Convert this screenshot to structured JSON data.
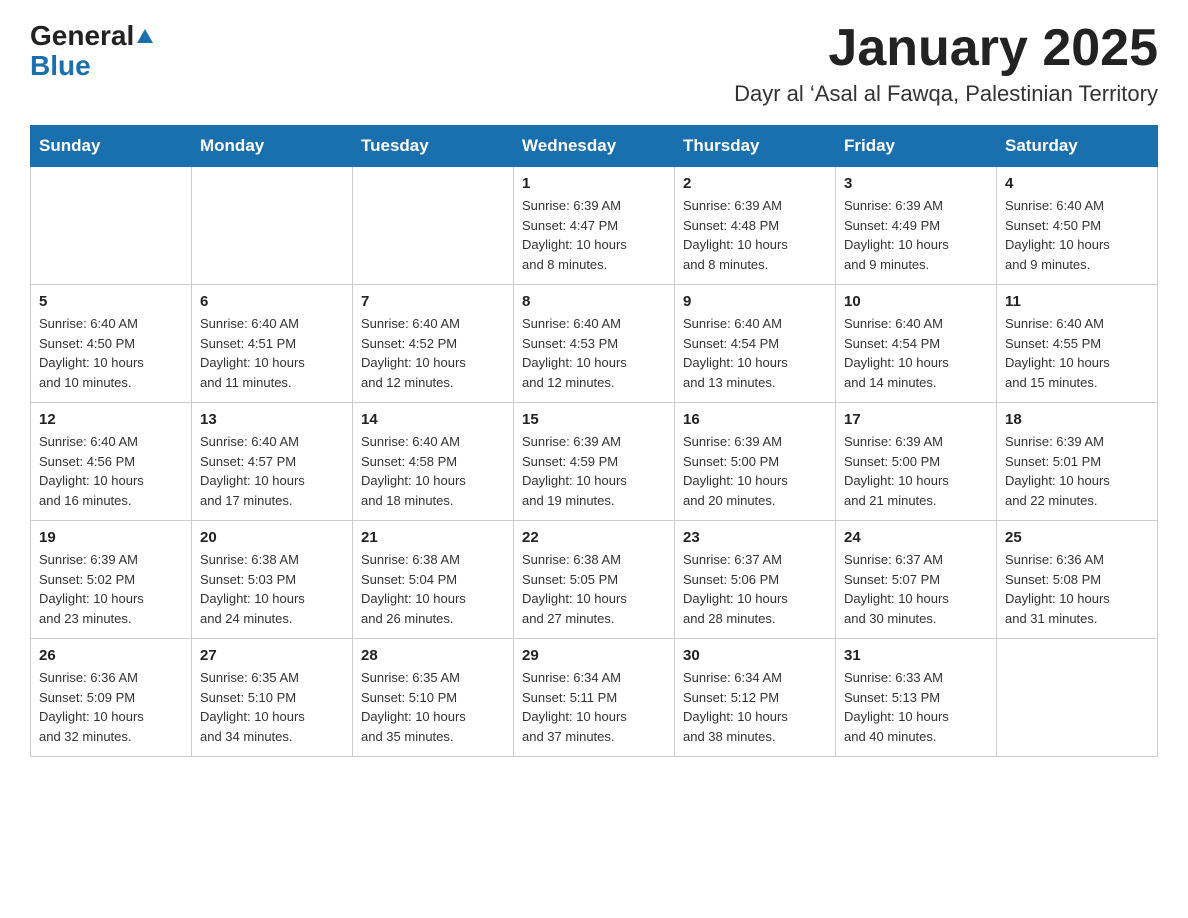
{
  "header": {
    "logo_general": "General",
    "logo_blue": "Blue",
    "title": "January 2025",
    "subtitle": "Dayr al ‘Asal al Fawqa, Palestinian Territory"
  },
  "weekdays": [
    "Sunday",
    "Monday",
    "Tuesday",
    "Wednesday",
    "Thursday",
    "Friday",
    "Saturday"
  ],
  "weeks": [
    [
      {
        "day": "",
        "info": ""
      },
      {
        "day": "",
        "info": ""
      },
      {
        "day": "",
        "info": ""
      },
      {
        "day": "1",
        "info": "Sunrise: 6:39 AM\nSunset: 4:47 PM\nDaylight: 10 hours\nand 8 minutes."
      },
      {
        "day": "2",
        "info": "Sunrise: 6:39 AM\nSunset: 4:48 PM\nDaylight: 10 hours\nand 8 minutes."
      },
      {
        "day": "3",
        "info": "Sunrise: 6:39 AM\nSunset: 4:49 PM\nDaylight: 10 hours\nand 9 minutes."
      },
      {
        "day": "4",
        "info": "Sunrise: 6:40 AM\nSunset: 4:50 PM\nDaylight: 10 hours\nand 9 minutes."
      }
    ],
    [
      {
        "day": "5",
        "info": "Sunrise: 6:40 AM\nSunset: 4:50 PM\nDaylight: 10 hours\nand 10 minutes."
      },
      {
        "day": "6",
        "info": "Sunrise: 6:40 AM\nSunset: 4:51 PM\nDaylight: 10 hours\nand 11 minutes."
      },
      {
        "day": "7",
        "info": "Sunrise: 6:40 AM\nSunset: 4:52 PM\nDaylight: 10 hours\nand 12 minutes."
      },
      {
        "day": "8",
        "info": "Sunrise: 6:40 AM\nSunset: 4:53 PM\nDaylight: 10 hours\nand 12 minutes."
      },
      {
        "day": "9",
        "info": "Sunrise: 6:40 AM\nSunset: 4:54 PM\nDaylight: 10 hours\nand 13 minutes."
      },
      {
        "day": "10",
        "info": "Sunrise: 6:40 AM\nSunset: 4:54 PM\nDaylight: 10 hours\nand 14 minutes."
      },
      {
        "day": "11",
        "info": "Sunrise: 6:40 AM\nSunset: 4:55 PM\nDaylight: 10 hours\nand 15 minutes."
      }
    ],
    [
      {
        "day": "12",
        "info": "Sunrise: 6:40 AM\nSunset: 4:56 PM\nDaylight: 10 hours\nand 16 minutes."
      },
      {
        "day": "13",
        "info": "Sunrise: 6:40 AM\nSunset: 4:57 PM\nDaylight: 10 hours\nand 17 minutes."
      },
      {
        "day": "14",
        "info": "Sunrise: 6:40 AM\nSunset: 4:58 PM\nDaylight: 10 hours\nand 18 minutes."
      },
      {
        "day": "15",
        "info": "Sunrise: 6:39 AM\nSunset: 4:59 PM\nDaylight: 10 hours\nand 19 minutes."
      },
      {
        "day": "16",
        "info": "Sunrise: 6:39 AM\nSunset: 5:00 PM\nDaylight: 10 hours\nand 20 minutes."
      },
      {
        "day": "17",
        "info": "Sunrise: 6:39 AM\nSunset: 5:00 PM\nDaylight: 10 hours\nand 21 minutes."
      },
      {
        "day": "18",
        "info": "Sunrise: 6:39 AM\nSunset: 5:01 PM\nDaylight: 10 hours\nand 22 minutes."
      }
    ],
    [
      {
        "day": "19",
        "info": "Sunrise: 6:39 AM\nSunset: 5:02 PM\nDaylight: 10 hours\nand 23 minutes."
      },
      {
        "day": "20",
        "info": "Sunrise: 6:38 AM\nSunset: 5:03 PM\nDaylight: 10 hours\nand 24 minutes."
      },
      {
        "day": "21",
        "info": "Sunrise: 6:38 AM\nSunset: 5:04 PM\nDaylight: 10 hours\nand 26 minutes."
      },
      {
        "day": "22",
        "info": "Sunrise: 6:38 AM\nSunset: 5:05 PM\nDaylight: 10 hours\nand 27 minutes."
      },
      {
        "day": "23",
        "info": "Sunrise: 6:37 AM\nSunset: 5:06 PM\nDaylight: 10 hours\nand 28 minutes."
      },
      {
        "day": "24",
        "info": "Sunrise: 6:37 AM\nSunset: 5:07 PM\nDaylight: 10 hours\nand 30 minutes."
      },
      {
        "day": "25",
        "info": "Sunrise: 6:36 AM\nSunset: 5:08 PM\nDaylight: 10 hours\nand 31 minutes."
      }
    ],
    [
      {
        "day": "26",
        "info": "Sunrise: 6:36 AM\nSunset: 5:09 PM\nDaylight: 10 hours\nand 32 minutes."
      },
      {
        "day": "27",
        "info": "Sunrise: 6:35 AM\nSunset: 5:10 PM\nDaylight: 10 hours\nand 34 minutes."
      },
      {
        "day": "28",
        "info": "Sunrise: 6:35 AM\nSunset: 5:10 PM\nDaylight: 10 hours\nand 35 minutes."
      },
      {
        "day": "29",
        "info": "Sunrise: 6:34 AM\nSunset: 5:11 PM\nDaylight: 10 hours\nand 37 minutes."
      },
      {
        "day": "30",
        "info": "Sunrise: 6:34 AM\nSunset: 5:12 PM\nDaylight: 10 hours\nand 38 minutes."
      },
      {
        "day": "31",
        "info": "Sunrise: 6:33 AM\nSunset: 5:13 PM\nDaylight: 10 hours\nand 40 minutes."
      },
      {
        "day": "",
        "info": ""
      }
    ]
  ]
}
